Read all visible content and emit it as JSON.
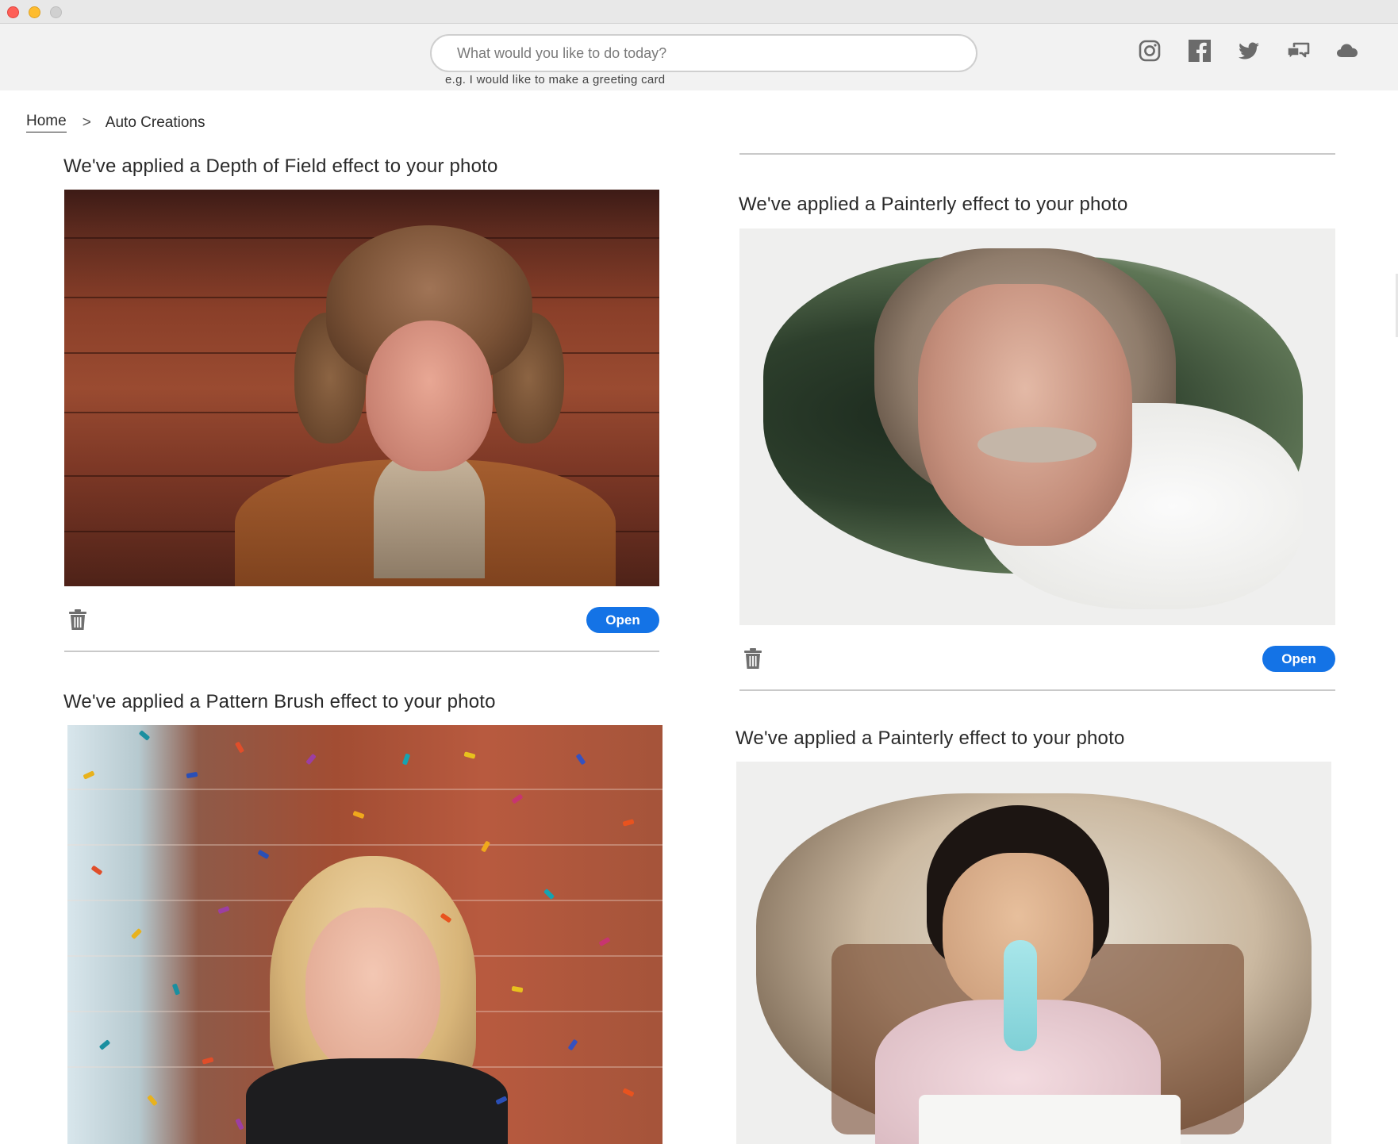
{
  "window": {
    "controls": [
      "close",
      "minimize",
      "maximize"
    ]
  },
  "header": {
    "search_placeholder": "What would you like to do today?",
    "search_hint": "e.g. I would like to make a greeting card",
    "social_icons": [
      "instagram-icon",
      "facebook-icon",
      "twitter-icon",
      "feedback-icon",
      "cloud-icon"
    ]
  },
  "breadcrumb": {
    "home": "Home",
    "separator": ">",
    "current": "Auto Creations"
  },
  "cards": [
    {
      "title": "We've applied a Depth of Field effect to your photo",
      "open_label": "Open"
    },
    {
      "title": "We've applied a Painterly effect to your photo",
      "open_label": "Open"
    },
    {
      "title": "We've applied a Pattern Brush effect to your photo"
    },
    {
      "title": "We've applied a Painterly effect to your photo"
    }
  ],
  "colors": {
    "accent": "#1473e6",
    "divider": "#c9c9c9",
    "header_bg": "#f2f2f2"
  }
}
